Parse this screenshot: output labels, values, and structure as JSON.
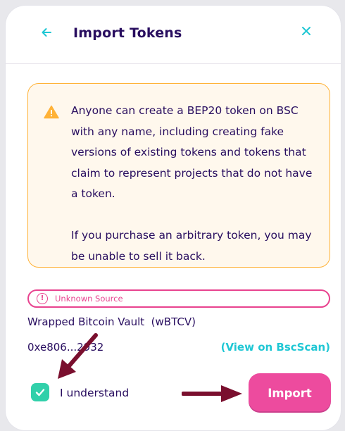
{
  "modal": {
    "title": "Import Tokens",
    "back_icon": "arrow-left-icon",
    "close_icon": "close-icon"
  },
  "warning": {
    "icon": "warning-triangle-icon",
    "paragraph1": "Anyone can create a BEP20 token on BSC with any name, including creating fake versions of existing tokens and tokens that claim to represent projects that do not have a token.",
    "paragraph2": "If you purchase an arbitrary token, you may be unable to sell it back."
  },
  "token": {
    "source_badge": "Unknown Source",
    "name": "Wrapped Bitcoin Vault  (wBTCV)",
    "address": "0xe806...2932",
    "view_link": "(View on BscScan)"
  },
  "acknowledge": {
    "checked": true,
    "label": "I understand"
  },
  "import_button": "Import",
  "colors": {
    "primary_text": "#280d5f",
    "accent_teal": "#1fc7d4",
    "pink": "#ed4b9e",
    "warning_border": "#ffb237",
    "warning_bg": "#fff8ed",
    "success": "#31d0aa",
    "annotation_arrow": "#7a0f2e"
  }
}
